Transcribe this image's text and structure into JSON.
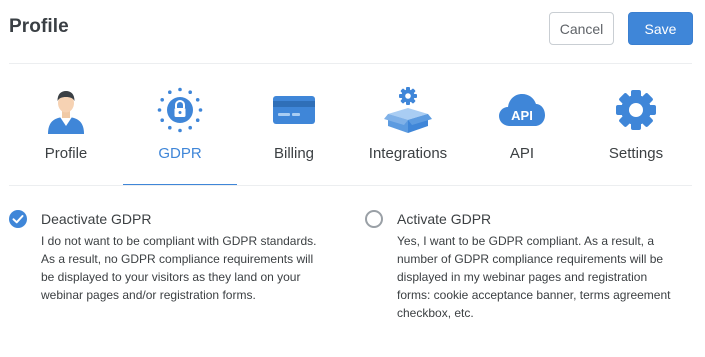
{
  "header": {
    "title": "Profile",
    "cancel_label": "Cancel",
    "save_label": "Save"
  },
  "tabs": [
    {
      "label": "Profile",
      "icon": "profile-avatar-icon",
      "active": false
    },
    {
      "label": "GDPR",
      "icon": "gdpr-lock-stars-icon",
      "active": true
    },
    {
      "label": "Billing",
      "icon": "credit-card-icon",
      "active": false
    },
    {
      "label": "Integrations",
      "icon": "box-gear-icon",
      "active": false
    },
    {
      "label": "API",
      "icon": "api-cloud-icon",
      "active": false
    },
    {
      "label": "Settings",
      "icon": "gear-icon",
      "active": false
    }
  ],
  "options": [
    {
      "title": "Deactivate GDPR",
      "description_lines": [
        "I do not want to be compliant with GDPR standards.",
        "As a result, no GDPR compliance requirements will",
        "be displayed to your visitors as they land on your",
        "webinar pages and/or registration forms."
      ],
      "selected": true
    },
    {
      "title": "Activate GDPR",
      "description_lines": [
        "Yes, I want to be GDPR compliant. As a result, a",
        "number of GDPR compliance requirements will be",
        "displayed in my webinar pages and registration",
        "forms: cookie acceptance banner, terms agreement",
        "checkbox, etc."
      ],
      "selected": false
    }
  ],
  "colors": {
    "accent": "#3f86d8",
    "text": "#3c4043",
    "divider": "#eceef0"
  }
}
